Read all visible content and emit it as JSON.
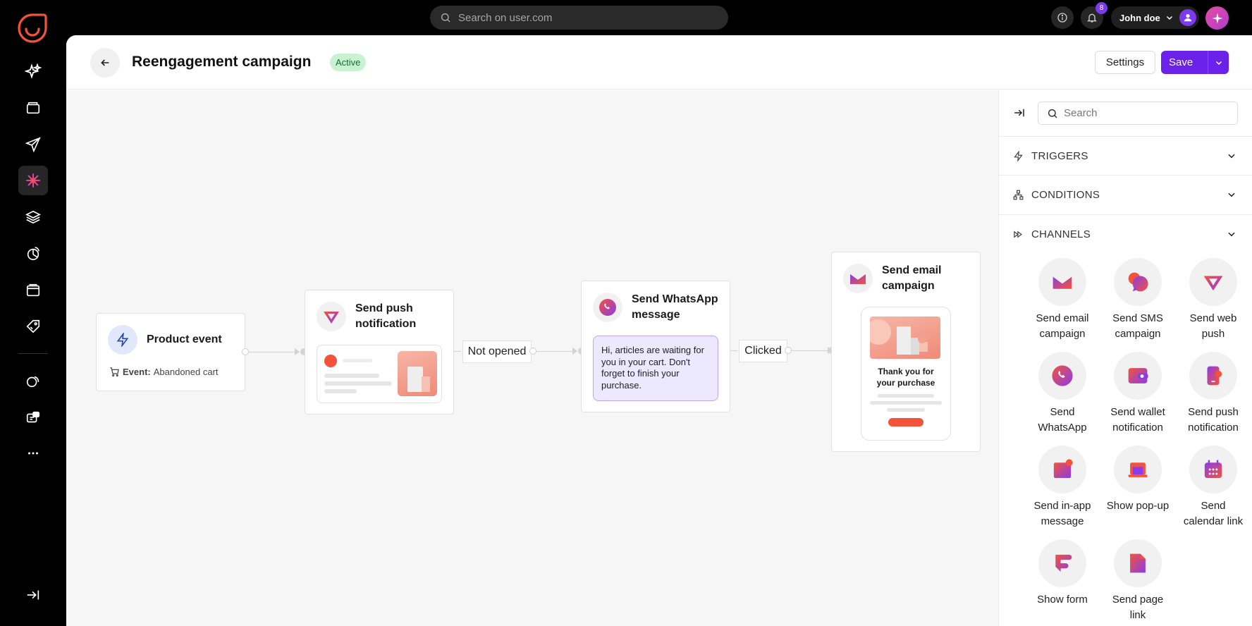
{
  "topbar": {
    "search_placeholder": "Search on user.com",
    "notification_count": "8",
    "user_name": "John doe"
  },
  "nav": {
    "items": [
      "sparkles-icon",
      "wallet-icon",
      "send-icon",
      "automation-icon",
      "layers-icon",
      "analytics-icon",
      "browser-icon",
      "tags-icon",
      "chat-icon",
      "support-icon",
      "more-icon"
    ]
  },
  "header": {
    "title": "Reengagement campaign",
    "status": "Active",
    "settings_label": "Settings",
    "save_label": "Save"
  },
  "canvas": {
    "nodes": {
      "product_event": {
        "title": "Product event",
        "event_prefix": "Event:",
        "event_value": "Abandoned cart"
      },
      "push": {
        "title_line1": "Send push",
        "title_line2": "notification"
      },
      "whatsapp": {
        "title_line1": "Send WhatsApp",
        "title_line2": "message",
        "message": "Hi, articles are waiting for you in your cart. Don't forget to finish your purchase."
      },
      "email": {
        "title_line1": "Send email",
        "title_line2": "campaign",
        "preview_line1": "Thank you for",
        "preview_line2": "your purchase"
      }
    },
    "connectors": {
      "not_opened": "Not opened",
      "clicked": "Clicked"
    }
  },
  "sidepanel": {
    "search_placeholder": "Search",
    "sections": {
      "triggers": "TRIGGERS",
      "conditions": "CONDITIONS",
      "channels": "CHANNELS"
    },
    "channels": [
      {
        "line1": "Send email",
        "line2": "campaign"
      },
      {
        "line1": "Send SMS",
        "line2": "campaign"
      },
      {
        "line1": "Send web",
        "line2": "push"
      },
      {
        "line1": "Send",
        "line2": "WhatsApp"
      },
      {
        "line1": "Send wallet",
        "line2": "notification"
      },
      {
        "line1": "Send push",
        "line2": "notification"
      },
      {
        "line1": "Send in-app",
        "line2": "message"
      },
      {
        "line1": "Show pop-up",
        "line2": ""
      },
      {
        "line1": "Send",
        "line2": "calendar link"
      },
      {
        "line1": "Show form",
        "line2": ""
      },
      {
        "line1": "Send page",
        "line2": "link"
      }
    ]
  },
  "colors": {
    "accent": "#6a22ea",
    "brand": "#f4523b",
    "active_badge_bg": "#c9f2d3"
  }
}
